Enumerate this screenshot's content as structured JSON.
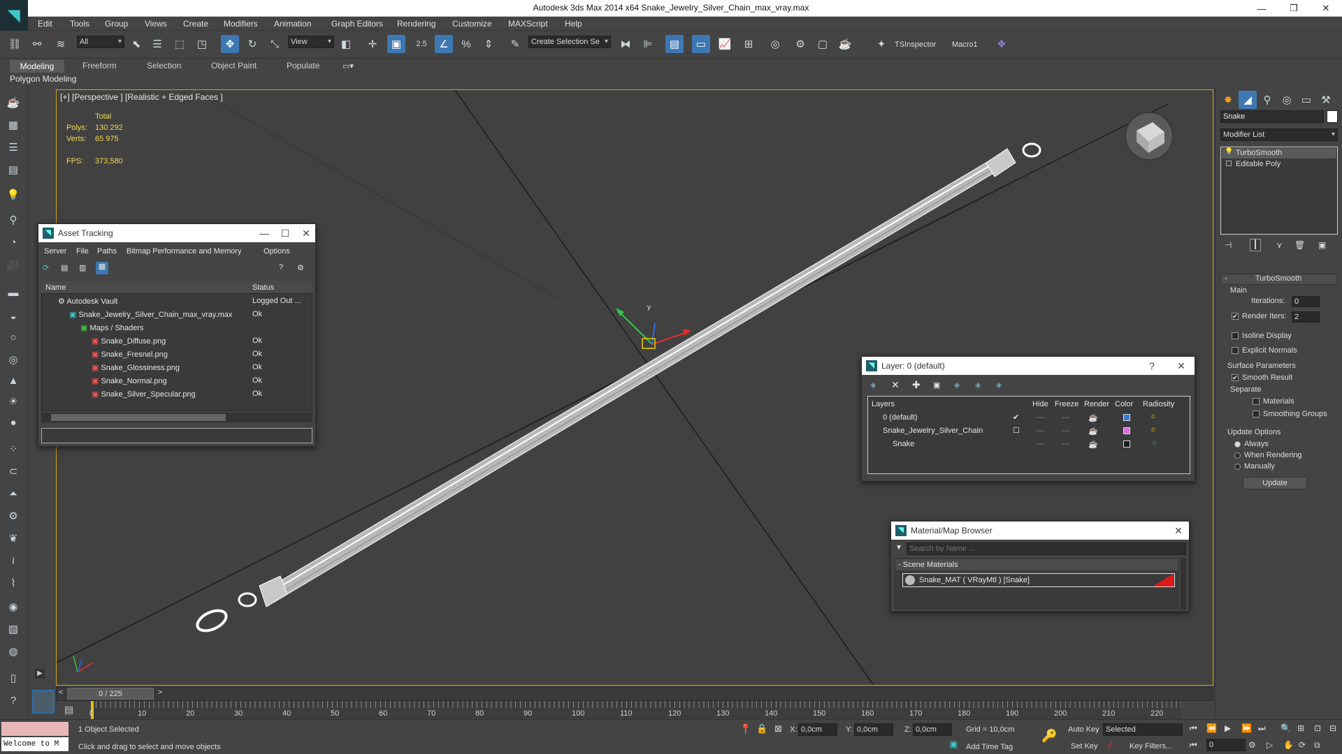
{
  "app": {
    "title": "Autodesk 3ds Max  2014 x64     Snake_Jewelry_Silver_Chain_max_vray.max"
  },
  "menu": [
    "Edit",
    "Tools",
    "Group",
    "Views",
    "Create",
    "Modifiers",
    "Animation",
    "Graph Editors",
    "Rendering",
    "Customize",
    "MAXScript",
    "Help"
  ],
  "toolbar": {
    "selection_filter": "All",
    "ref_coord": "View",
    "snap_value": "2.5",
    "named_selection": "Create Selection Se",
    "ts_inspector": "TSInspector",
    "macro": "Macro1"
  },
  "ribbon": {
    "tabs": [
      "Modeling",
      "Freeform",
      "Selection",
      "Object Paint",
      "Populate"
    ],
    "sub_label": "Polygon Modeling"
  },
  "viewport": {
    "label": "[+] [Perspective ] [Realistic + Edged Faces ]",
    "stats_header": "Total",
    "polys_label": "Polys:",
    "polys_value": "130 292",
    "verts_label": "Verts:",
    "verts_value": "65 975",
    "fps_label": "FPS:",
    "fps_value": "373,580",
    "gizmo_y": "y"
  },
  "asset_tracking": {
    "title": "Asset Tracking",
    "menu": [
      "Server",
      "File",
      "Paths",
      "Bitmap Performance and Memory",
      "Options"
    ],
    "col_name": "Name",
    "col_status": "Status",
    "rows": [
      {
        "name": "Autodesk Vault",
        "status": "Logged Out ..."
      },
      {
        "name": "Snake_Jewelry_Silver_Chain_max_vray.max",
        "status": "Ok"
      },
      {
        "name": "Maps / Shaders",
        "status": ""
      },
      {
        "name": "Snake_Diffuse.png",
        "status": "Ok"
      },
      {
        "name": "Snake_Fresnel.png",
        "status": "Ok"
      },
      {
        "name": "Snake_Glossiness.png",
        "status": "Ok"
      },
      {
        "name": "Snake_Normal.png",
        "status": "Ok"
      },
      {
        "name": "Snake_Silver_Specular.png",
        "status": "Ok"
      }
    ]
  },
  "layer_window": {
    "title": "Layer: 0 (default)",
    "help": "?",
    "columns": [
      "Layers",
      "Hide",
      "Freeze",
      "Render",
      "Color",
      "Radiosity"
    ],
    "rows": [
      {
        "name": "0 (default)",
        "color": "#3a7bd5"
      },
      {
        "name": "Snake_Jewelry_Silver_Chain",
        "color": "#d66adf"
      },
      {
        "name": "Snake",
        "color": "#1a1a1a"
      }
    ]
  },
  "material_browser": {
    "title": "Material/Map Browser",
    "search_placeholder": "Search by Name ...",
    "group": "- Scene Materials",
    "item": "Snake_MAT  ( VRayMtl )  [Snake]"
  },
  "command_panel": {
    "object_name": "Snake",
    "modifier_list": "Modifier List",
    "stack": [
      "TurboSmooth",
      "Editable Poly"
    ],
    "rollout_title": "TurboSmooth",
    "main_label": "Main",
    "iterations_label": "Iterations:",
    "iterations_value": "0",
    "render_iters_label": "Render Iters:",
    "render_iters_value": "2",
    "isoline": "Isoline Display",
    "explicit_normals": "Explicit Normals",
    "surface_params": "Surface Parameters",
    "smooth_result": "Smooth Result",
    "separate": "Separate",
    "materials": "Materials",
    "smoothing_groups": "Smoothing Groups",
    "update_options": "Update Options",
    "always": "Always",
    "when_rendering": "When Rendering",
    "manually": "Manually",
    "update_button": "Update"
  },
  "timeline": {
    "frame": "0 / 225",
    "ticks": [
      "0",
      "10",
      "20",
      "30",
      "40",
      "50",
      "60",
      "70",
      "80",
      "90",
      "100",
      "110",
      "120",
      "130",
      "140",
      "150",
      "160",
      "170",
      "180",
      "190",
      "200",
      "210",
      "220"
    ]
  },
  "status": {
    "maxscript": "Welcome to M",
    "selected": "1 Object Selected",
    "prompt": "Click and drag to select and move objects",
    "x_label": "X:",
    "x_value": "0,0cm",
    "y_label": "Y:",
    "y_value": "0,0cm",
    "z_label": "Z:",
    "z_value": "0,0cm",
    "grid": "Grid = 10,0cm",
    "auto_key": "Auto Key",
    "set_key": "Set Key",
    "key_mode": "Selected",
    "key_filters": "Key Filters...",
    "add_time_tag": "Add Time Tag",
    "frame_field": "0"
  }
}
